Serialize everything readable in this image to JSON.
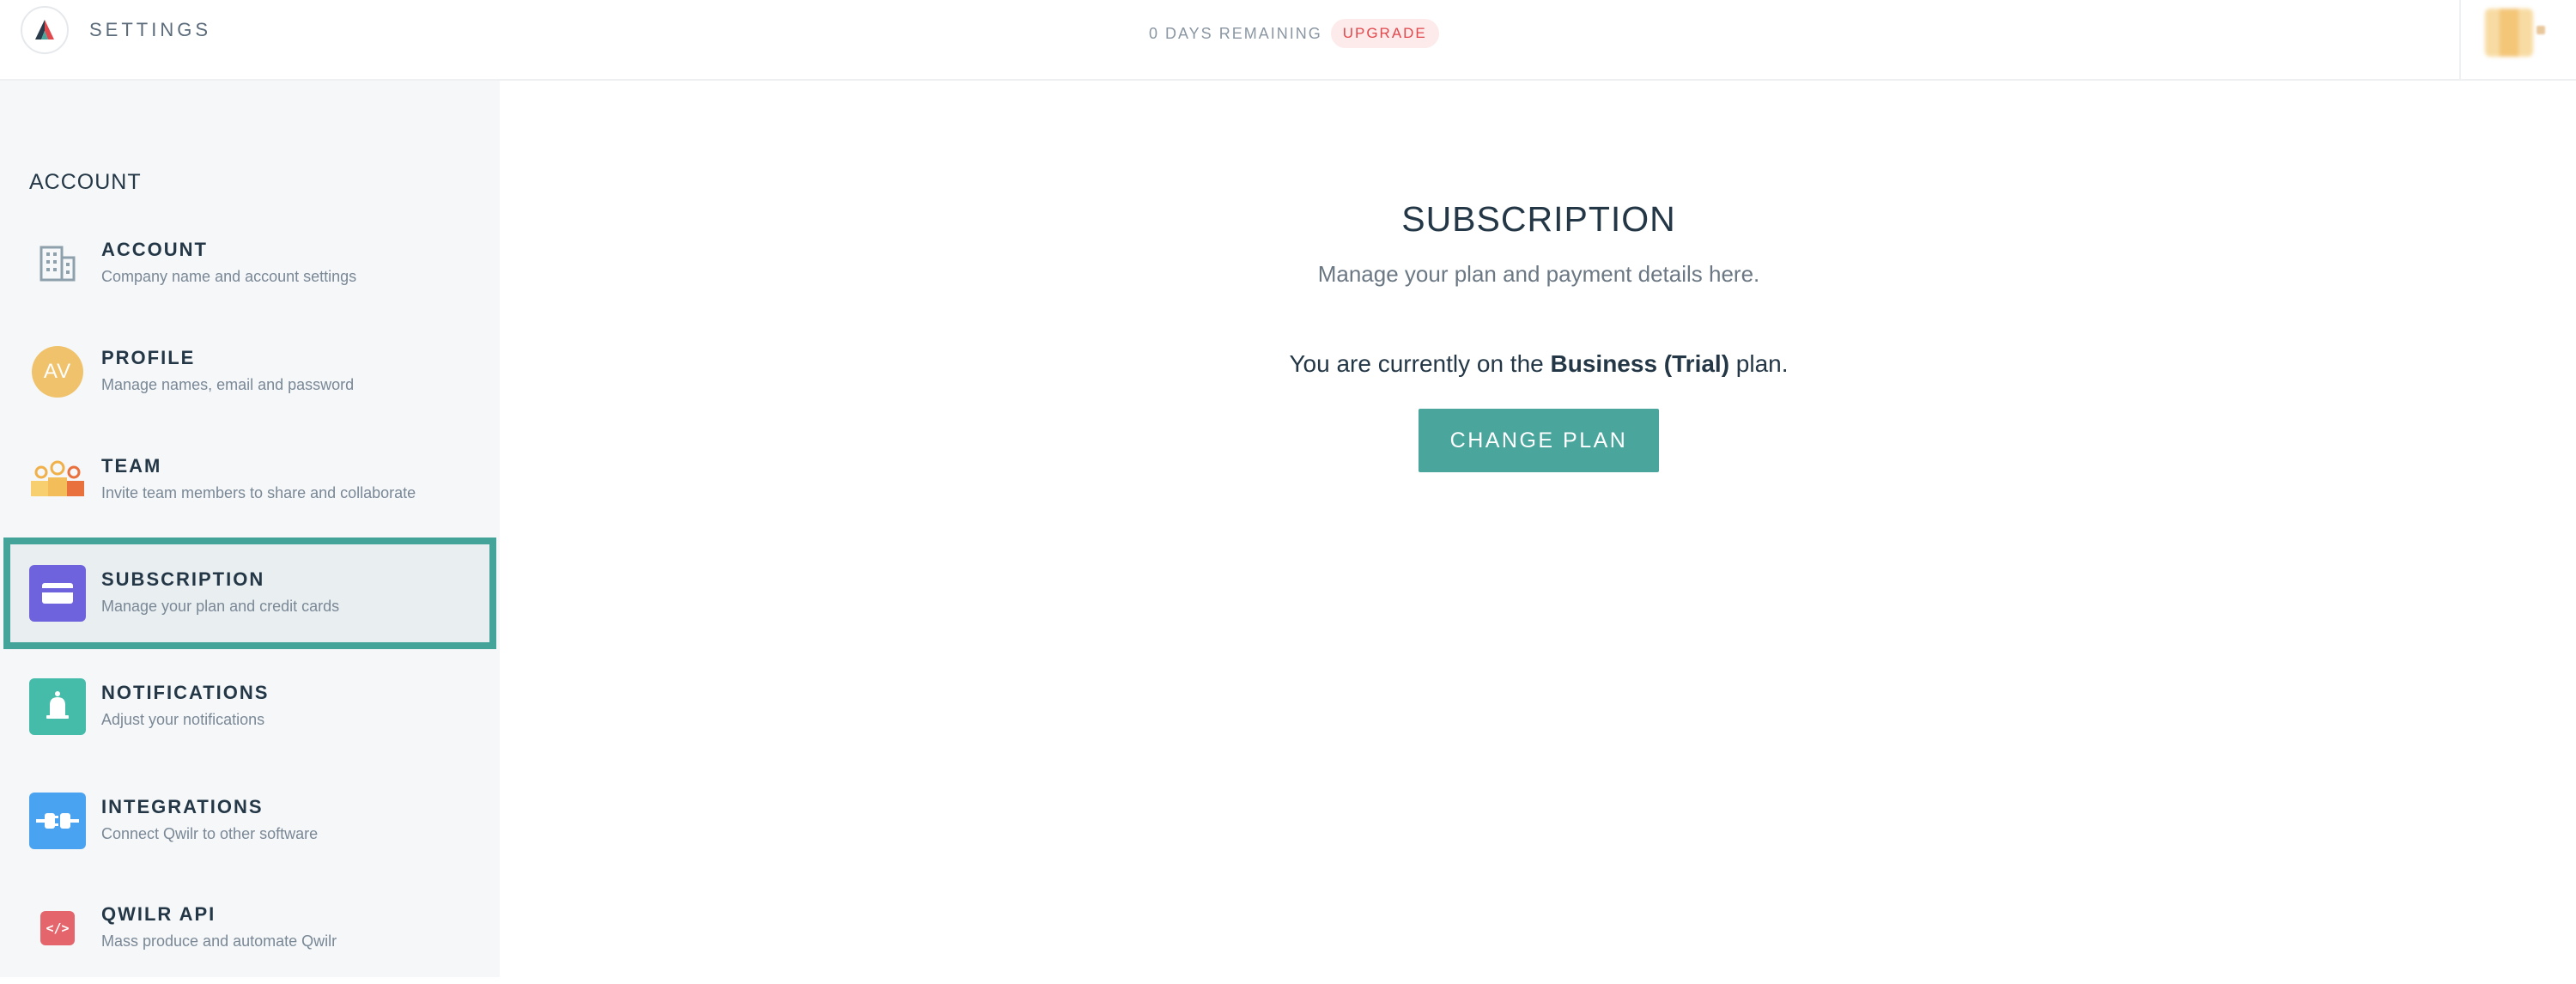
{
  "header": {
    "title": "SETTINGS",
    "trial_text": "0 DAYS REMAINING",
    "upgrade_label": "UPGRADE"
  },
  "sidebar": {
    "section_title": "ACCOUNT",
    "items": [
      {
        "label": "ACCOUNT",
        "description": "Company name and account settings",
        "icon": "building-icon"
      },
      {
        "label": "PROFILE",
        "description": "Manage names, email and password",
        "icon": "avatar-initials-icon",
        "initials": "AV"
      },
      {
        "label": "TEAM",
        "description": "Invite team members to share and collaborate",
        "icon": "team-icon"
      },
      {
        "label": "SUBSCRIPTION",
        "description": "Manage your plan and credit cards",
        "icon": "credit-card-icon",
        "active": true
      },
      {
        "label": "NOTIFICATIONS",
        "description": "Adjust your notifications",
        "icon": "bell-icon"
      },
      {
        "label": "INTEGRATIONS",
        "description": "Connect Qwilr to other software",
        "icon": "plug-icon"
      },
      {
        "label": "QWILR API",
        "description": "Mass produce and automate Qwilr",
        "icon": "code-icon"
      }
    ]
  },
  "main": {
    "title": "SUBSCRIPTION",
    "subtitle": "Manage your plan and payment details here.",
    "plan_prefix": "You are currently on the ",
    "plan_name": "Business (Trial)",
    "plan_suffix": " plan.",
    "button_label": "CHANGE PLAN"
  },
  "colors": {
    "accent": "#4aa69c",
    "upgrade": "#e0484d",
    "subscription_icon": "#6f63dd",
    "notifications_icon": "#45bba9",
    "integrations_icon": "#4aa3f0",
    "api_icon": "#e4656b",
    "profile_avatar": "#f0c26b"
  }
}
